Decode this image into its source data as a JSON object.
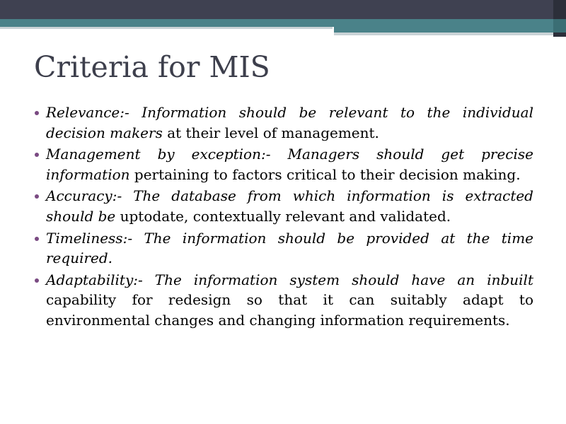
{
  "slide": {
    "title": "Criteria for MIS",
    "bullets": [
      {
        "italic": "Relevance:- Information should be relevant to the individual decision makers",
        "normal": " at their level of management."
      },
      {
        "italic": "Management by exception:- Managers should get precise information",
        "normal": " pertaining to factors critical to their decision making."
      },
      {
        "italic": " Accuracy:- The database from which information is extracted should be",
        "normal": " uptodate, contextually relevant and validated."
      },
      {
        "italic": "Timeliness:- The information should be provided at the time required.",
        "normal": ""
      },
      {
        "italic": "Adaptability:- The information system should have an inbuilt",
        "normal": " capability for redesign so that it can suitably adapt to environmental changes and changing information requirements."
      }
    ]
  },
  "colors": {
    "banner_dark": "#3f4151",
    "banner_teal": "#4a8289",
    "banner_light": "#c9d3d6",
    "title_text": "#3d3f4c",
    "bullet_marker": "#7a4a82"
  },
  "icons": {
    "bullet_marker": "bullet-dot-icon"
  }
}
